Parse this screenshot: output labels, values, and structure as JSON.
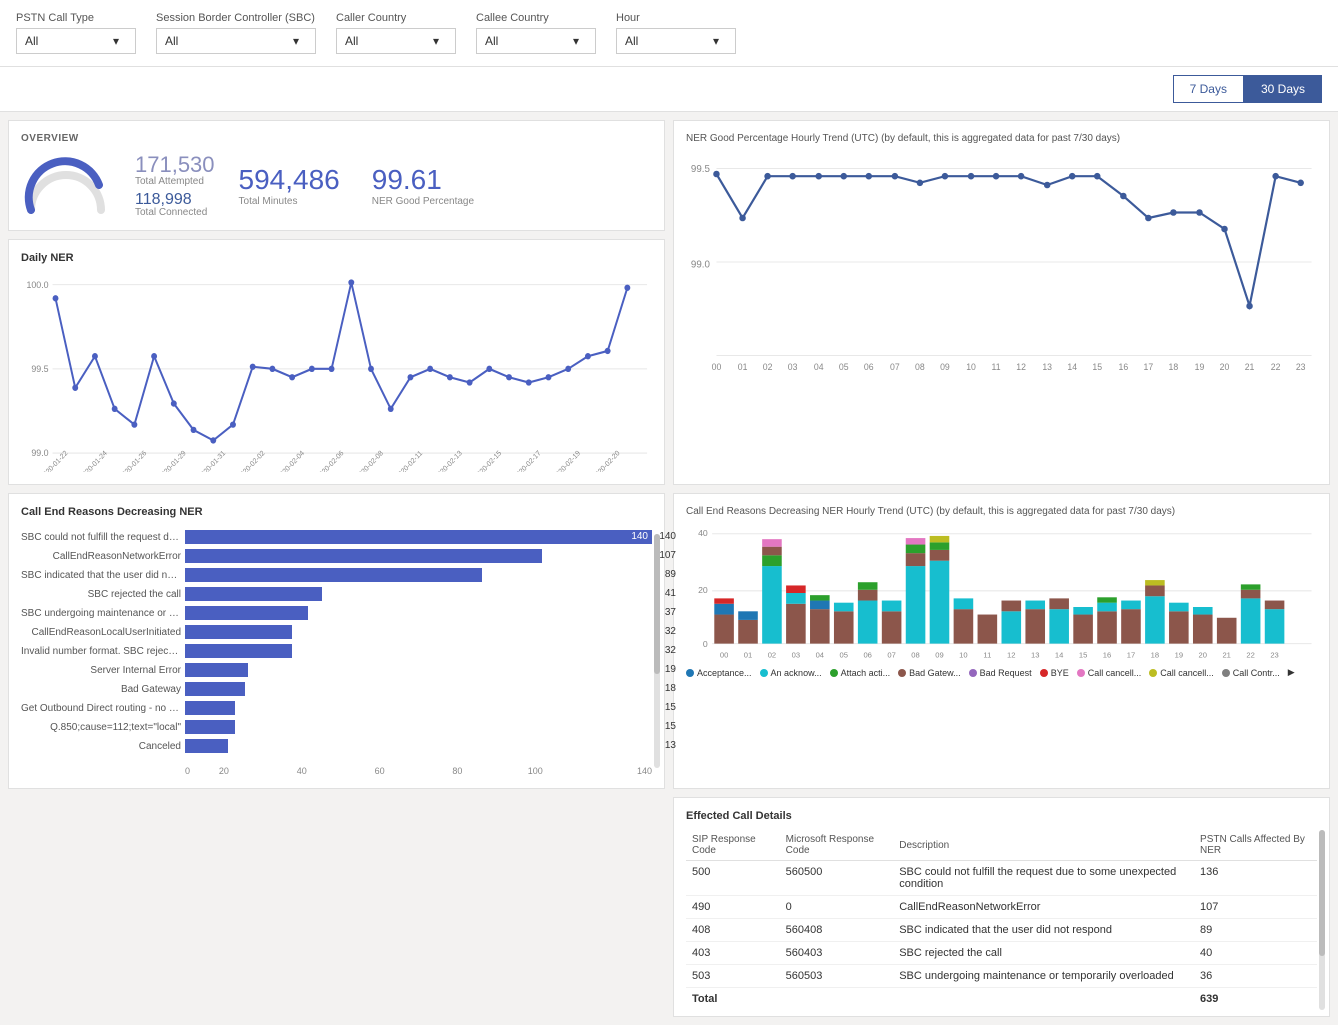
{
  "filters": {
    "pstn_label": "PSTN Call Type",
    "pstn_value": "All",
    "sbc_label": "Session Border Controller (SBC)",
    "sbc_value": "All",
    "caller_label": "Caller Country",
    "caller_value": "All",
    "callee_label": "Callee Country",
    "callee_value": "All",
    "hour_label": "Hour",
    "hour_value": "All"
  },
  "day_buttons": {
    "seven": "7 Days",
    "thirty": "30 Days"
  },
  "overview": {
    "title": "OVERVIEW",
    "total_attempted": "171,530",
    "total_attempted_label": "Total Attempted",
    "total_connected": "118,998",
    "total_connected_label": "Total Connected",
    "total_minutes": "594,486",
    "total_minutes_label": "Total Minutes",
    "ner_good": "99.61",
    "ner_good_label": "NER Good Percentage"
  },
  "daily_ner": {
    "title": "Daily NER",
    "y_max": "100.0",
    "y_mid": "99.5",
    "y_min": "99.0"
  },
  "call_end_reasons": {
    "title": "Call End Reasons Decreasing NER",
    "bars": [
      {
        "label": "SBC could not fulfill the request due...",
        "value": 140,
        "max": 140
      },
      {
        "label": "CallEndReasonNetworkError",
        "value": 107,
        "max": 140
      },
      {
        "label": "SBC indicated that the user did not r...",
        "value": 89,
        "max": 140
      },
      {
        "label": "SBC rejected the call",
        "value": 41,
        "max": 140
      },
      {
        "label": "SBC undergoing maintenance or te...",
        "value": 37,
        "max": 140
      },
      {
        "label": "CallEndReasonLocalUserInitiated",
        "value": 32,
        "max": 140
      },
      {
        "label": "Invalid number format. SBC rejected...",
        "value": 32,
        "max": 140
      },
      {
        "label": "Server Internal Error",
        "value": 19,
        "max": 140
      },
      {
        "label": "Bad Gateway",
        "value": 18,
        "max": 140
      },
      {
        "label": "Get Outbound Direct routing - no tr...",
        "value": 15,
        "max": 140
      },
      {
        "label": "Q.850;cause=112;text=\"local\"",
        "value": 15,
        "max": 140
      },
      {
        "label": "Canceled",
        "value": 13,
        "max": 140
      }
    ],
    "x_labels": [
      "0",
      "20",
      "40",
      "60",
      "80",
      "100",
      "140"
    ]
  },
  "ner_trend": {
    "title": "NER Good Percentage Hourly Trend (UTC) (by default, this is aggregated data for past 7/30 days)",
    "y_max": "99.5",
    "y_min": "99.0",
    "x_labels": [
      "00",
      "01",
      "02",
      "03",
      "04",
      "05",
      "06",
      "07",
      "08",
      "09",
      "10",
      "11",
      "12",
      "13",
      "14",
      "15",
      "16",
      "17",
      "18",
      "19",
      "20",
      "21",
      "22",
      "23"
    ]
  },
  "call_end_hourly": {
    "title": "Call End Reasons Decreasing NER Hourly Trend (UTC) (by default, this is aggregated data for past 7/30 days)",
    "y_max": "40",
    "y_mid": "20",
    "y_min": "0",
    "x_labels": [
      "00",
      "01",
      "02",
      "03",
      "04",
      "05",
      "06",
      "07",
      "08",
      "09",
      "10",
      "11",
      "12",
      "13",
      "14",
      "15",
      "16",
      "17",
      "18",
      "19",
      "20",
      "21",
      "22",
      "23"
    ],
    "legend": [
      {
        "label": "Acceptance...",
        "color": "#1f77b4"
      },
      {
        "label": "An acknow...",
        "color": "#17becf"
      },
      {
        "label": "Attach acti...",
        "color": "#2ca02c"
      },
      {
        "label": "Bad Gatew...",
        "color": "#8c564b"
      },
      {
        "label": "Bad Request",
        "color": "#9467bd"
      },
      {
        "label": "BYE",
        "color": "#d62728"
      },
      {
        "label": "Call cancell...",
        "color": "#e377c2"
      },
      {
        "label": "Call cancell...",
        "color": "#bcbd22"
      },
      {
        "label": "Call Contr...",
        "color": "#7f7f7f"
      }
    ]
  },
  "effected_calls": {
    "title": "Effected Call Details",
    "columns": [
      "SIP Response Code",
      "Microsoft Response Code",
      "Description",
      "PSTN Calls Affected By NER"
    ],
    "rows": [
      {
        "sip": "500",
        "ms": "560500",
        "desc": "SBC could not fulfill the request due to some unexpected condition",
        "calls": "136"
      },
      {
        "sip": "490",
        "ms": "0",
        "desc": "CallEndReasonNetworkError",
        "calls": "107"
      },
      {
        "sip": "408",
        "ms": "560408",
        "desc": "SBC indicated that the user did not respond",
        "calls": "89"
      },
      {
        "sip": "403",
        "ms": "560403",
        "desc": "SBC rejected the call",
        "calls": "40"
      },
      {
        "sip": "503",
        "ms": "560503",
        "desc": "SBC undergoing maintenance or temporarily overloaded",
        "calls": "36"
      }
    ],
    "total_label": "Total",
    "total_value": "639"
  }
}
